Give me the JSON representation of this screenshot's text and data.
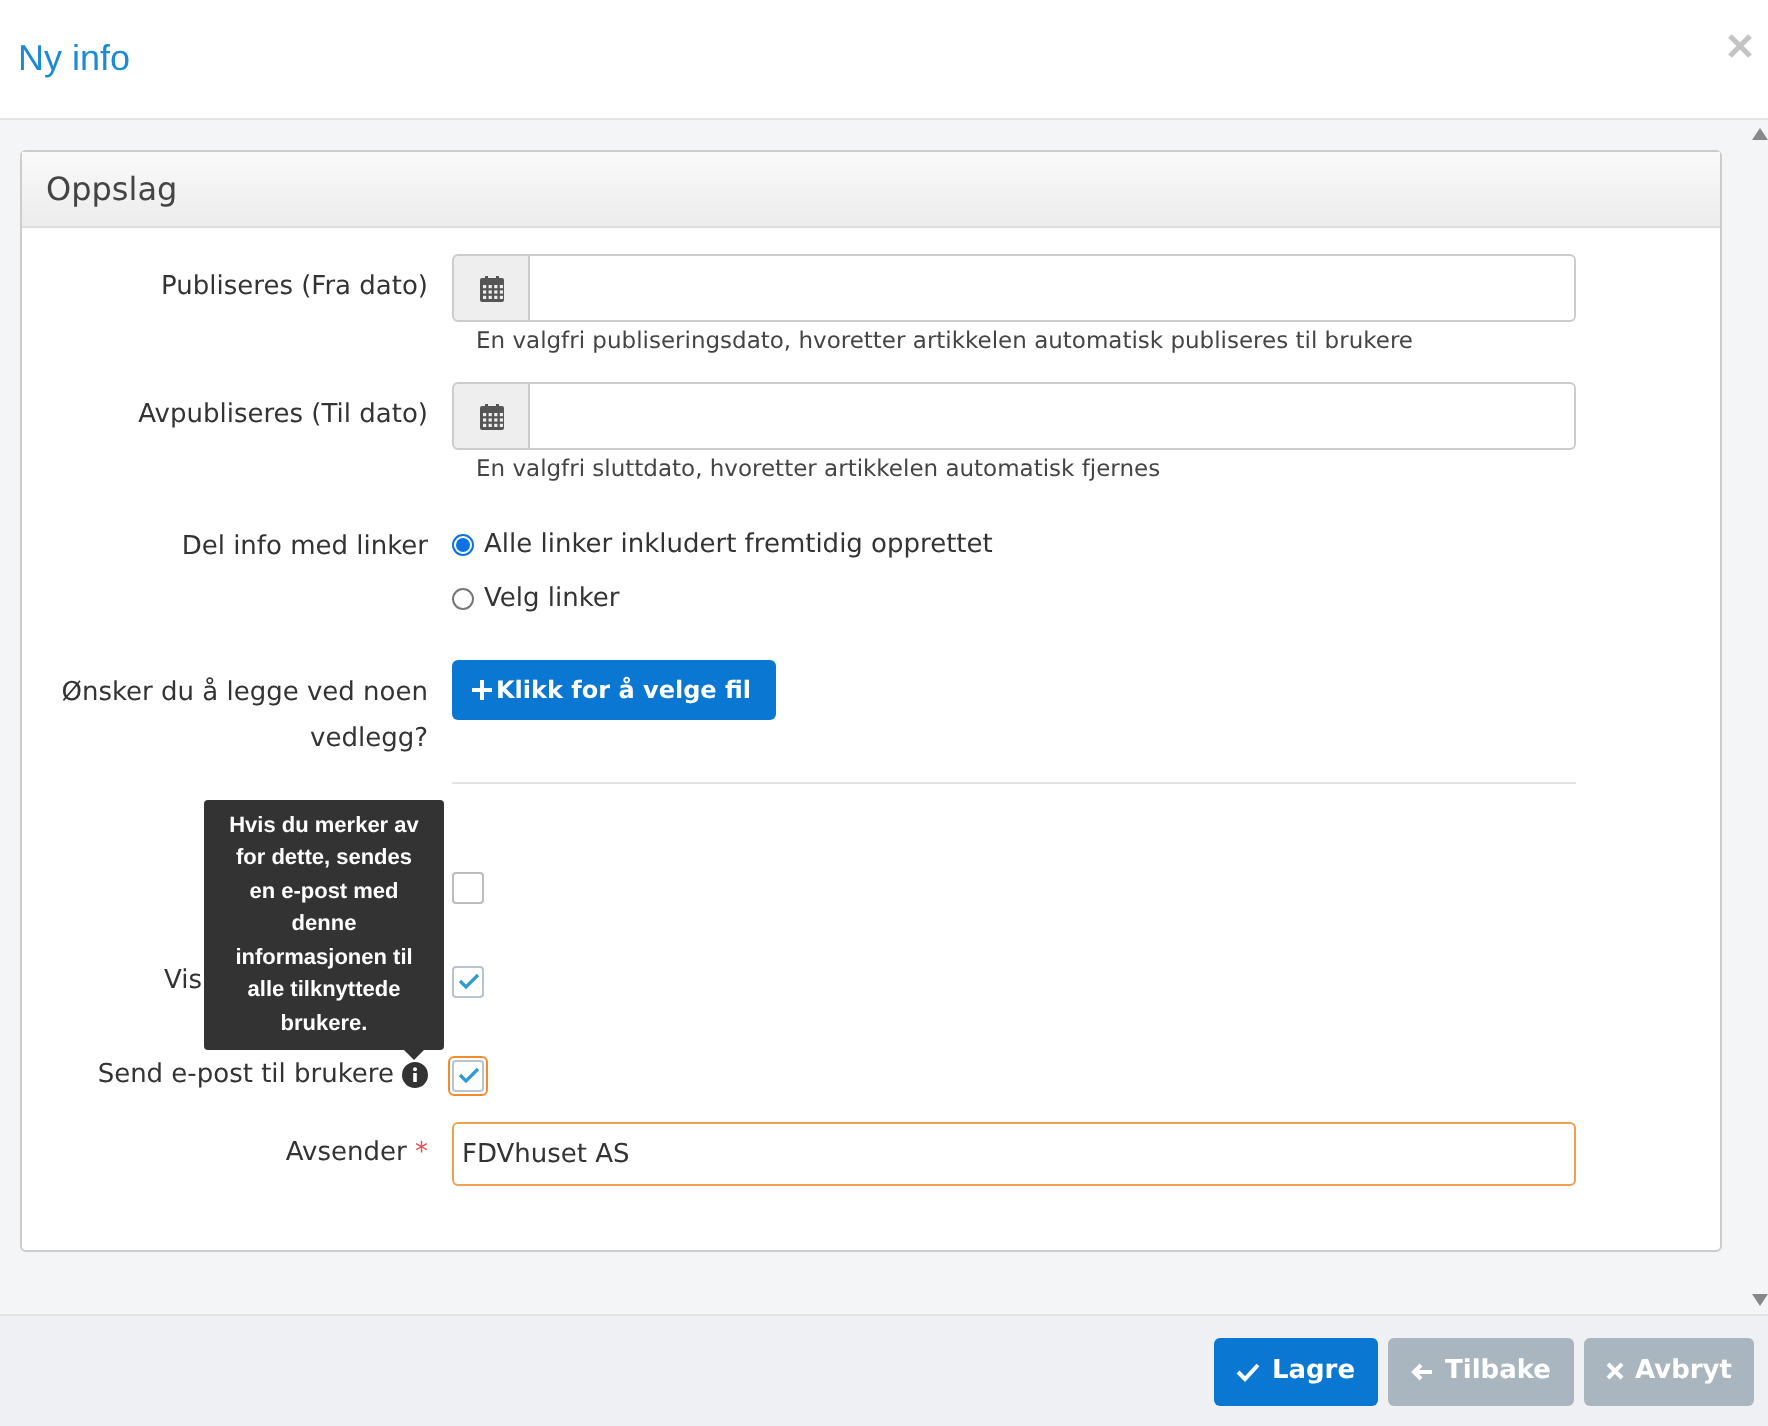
{
  "window": {
    "title": "Ny info"
  },
  "panel": {
    "title": "Oppslag"
  },
  "date_fields": [
    {
      "label": "Publiseres (Fra dato)",
      "help": "En valgfri publiseringsdato, hvoretter artikkelen automatisk publiseres til brukere"
    },
    {
      "label": "Avpubliseres (Til dato)",
      "help": "En valgfri sluttdato, hvoretter artikkelen automatisk fjernes"
    }
  ],
  "share": {
    "label": "Del info med linker",
    "options": [
      {
        "label": "Alle linker inkludert fremtidig opprettet",
        "selected": true
      },
      {
        "label": "Velg linker",
        "selected": false
      }
    ]
  },
  "attachment": {
    "label": "Ønsker du å legge ved noen vedlegg?",
    "button": "Klikk for å velge fil"
  },
  "checkboxes": [
    {
      "checked": false,
      "focused": false,
      "info": false
    },
    {
      "label": "Vis",
      "checked": true,
      "focused": false,
      "info": false
    },
    {
      "label": "Send e-post til brukere",
      "checked": true,
      "focused": true,
      "info": true
    }
  ],
  "tooltip": "Hvis du merker av for dette, sendes en e-post med denne informasjonen til alle tilknyttede brukere.",
  "sender": {
    "label": "Avsender",
    "required_mark": "*",
    "value": "FDVhuset AS"
  },
  "buttons": [
    {
      "label": "Lagre",
      "kind": "primary"
    },
    {
      "label": "Tilbake",
      "kind": "back"
    },
    {
      "label": "Avbryt",
      "kind": "cancel"
    }
  ]
}
